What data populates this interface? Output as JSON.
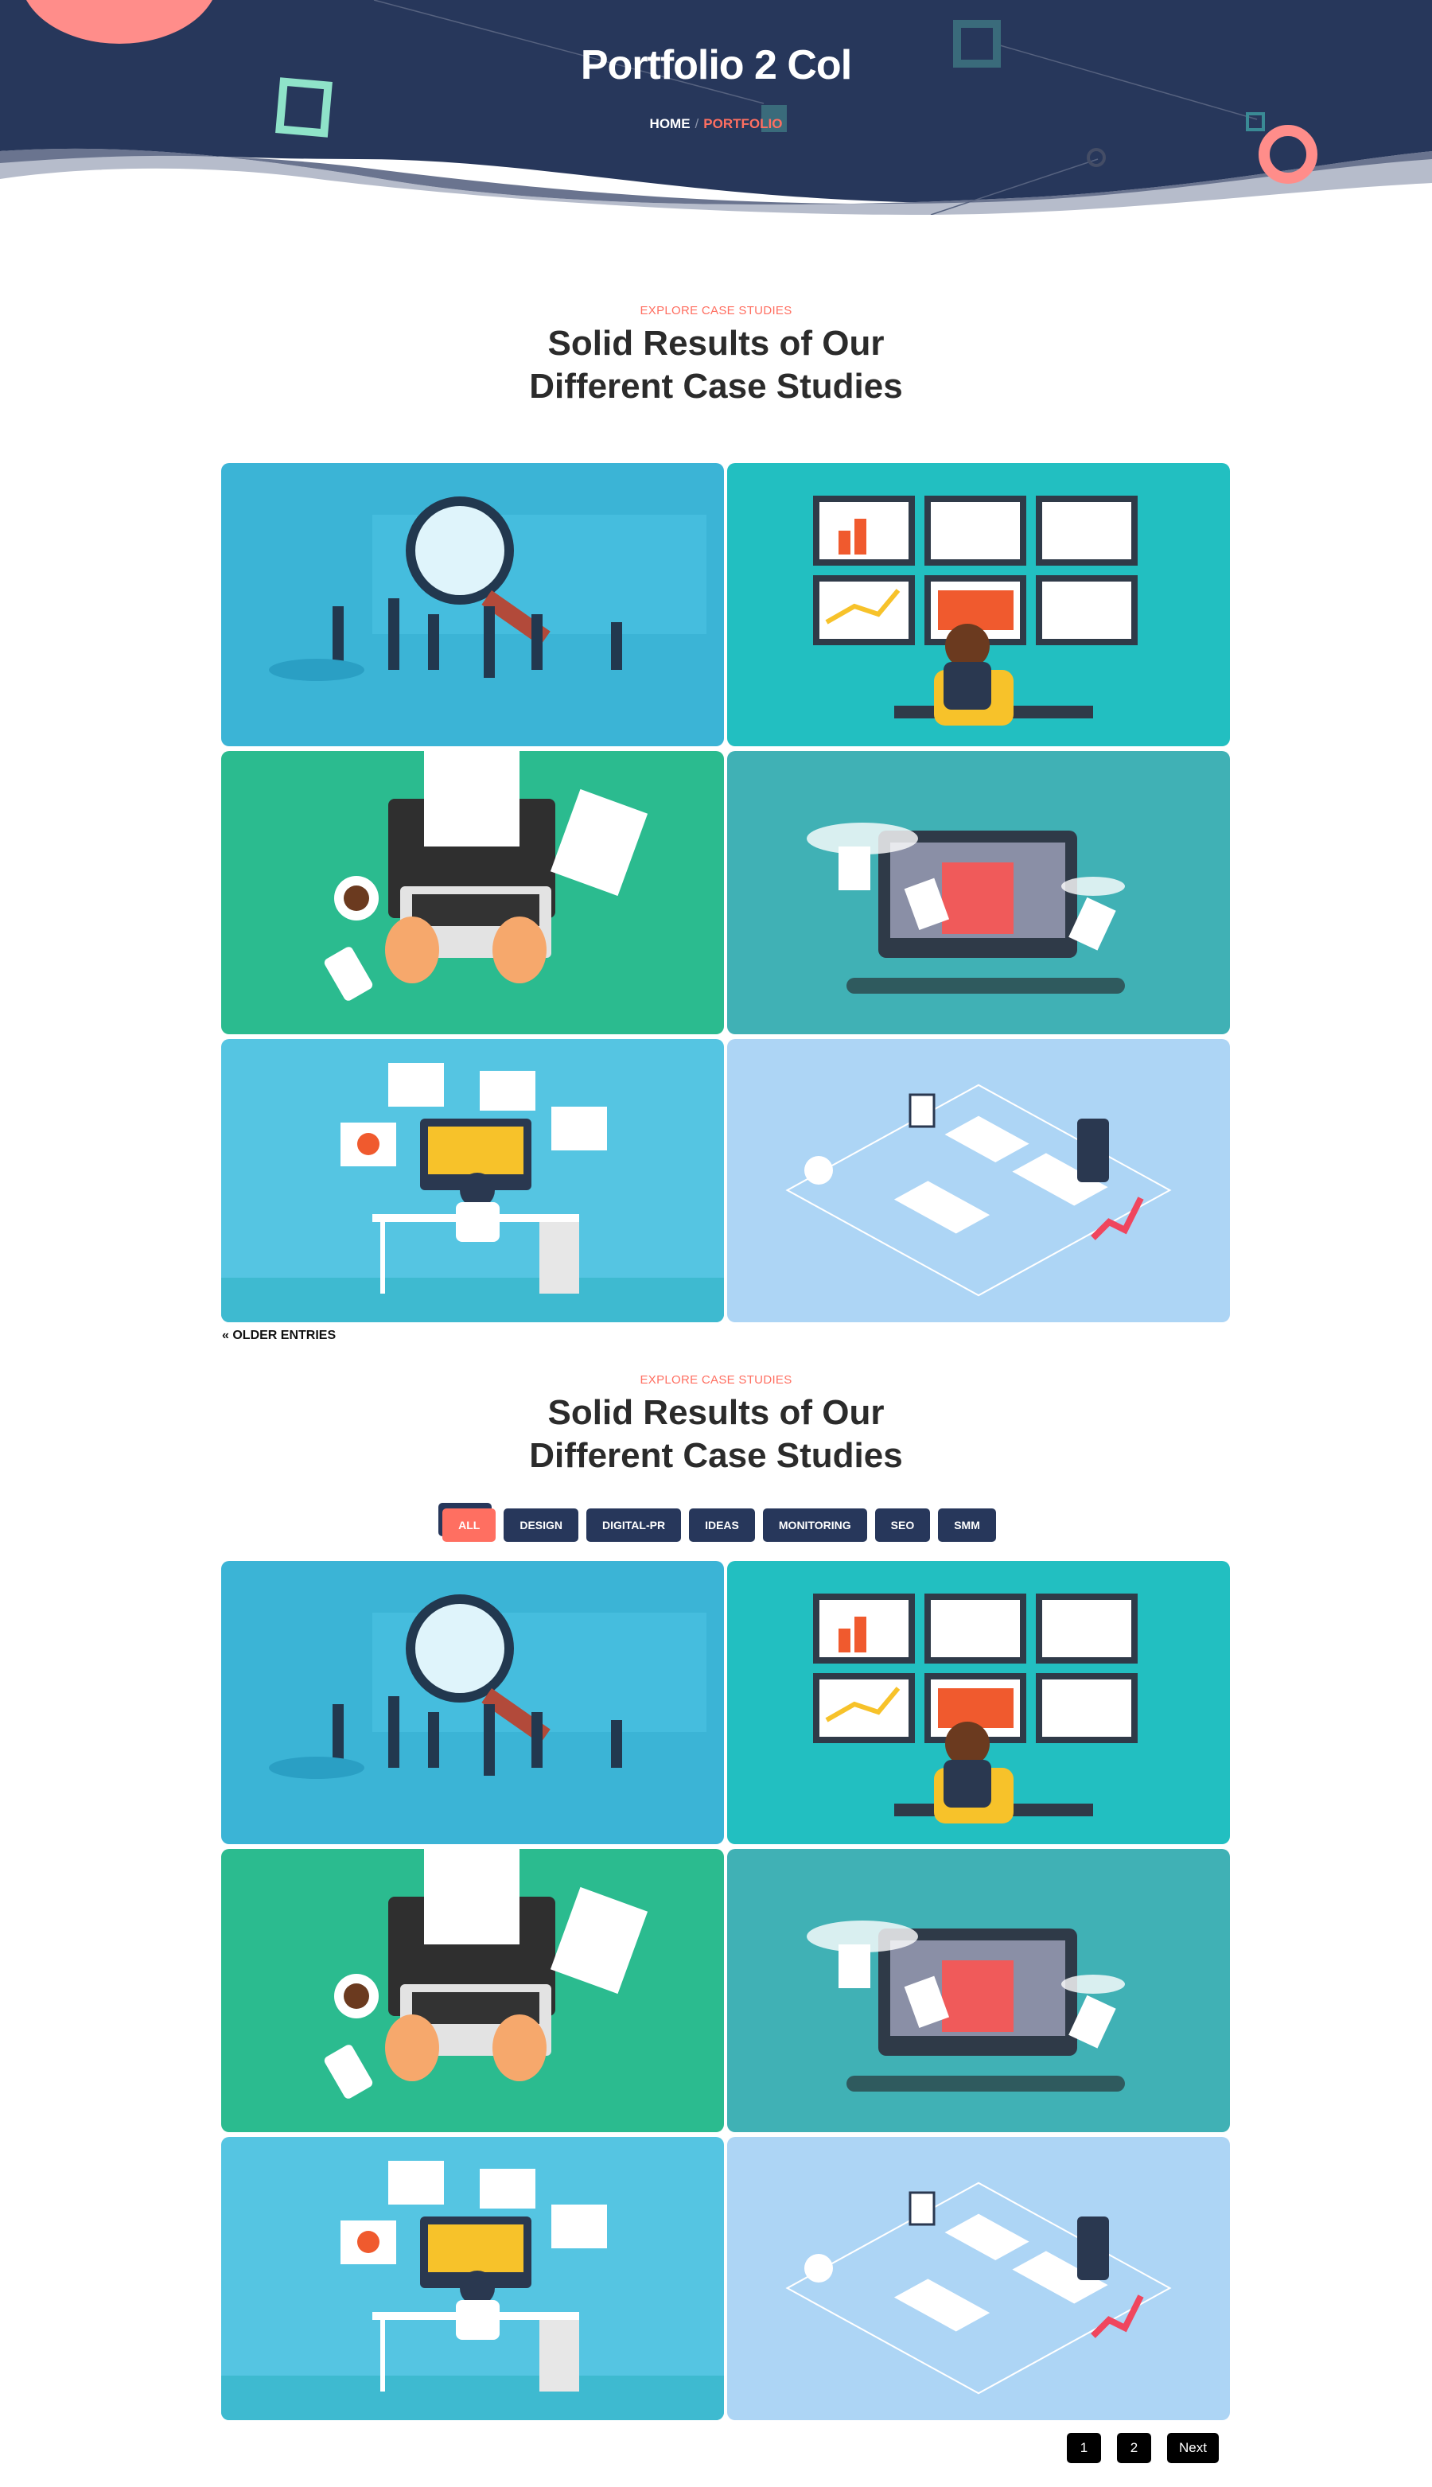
{
  "hero": {
    "title": "Portfolio 2 Col",
    "breadcrumb": {
      "home": "HOME",
      "separator": "/",
      "current": "PORTFOLIO"
    }
  },
  "colors": {
    "navy": "#27375b",
    "coral": "#ff6f61",
    "mint": "#8fe3c9"
  },
  "section1": {
    "eyebrow": "EXPLORE CASE STUDIES",
    "heading_line1": "Solid Results of Our",
    "heading_line2": "Different Case Studies"
  },
  "older_entries": "« OLDER ENTRIES",
  "section2": {
    "eyebrow": "EXPLORE CASE STUDIES",
    "heading_line1": "Solid Results of Our",
    "heading_line2": "Different Case Studies"
  },
  "filters": [
    {
      "label": "ALL",
      "active": true
    },
    {
      "label": "DESIGN"
    },
    {
      "label": "DIGITAL-PR"
    },
    {
      "label": "IDEAS"
    },
    {
      "label": "MONITORING"
    },
    {
      "label": "SEO"
    },
    {
      "label": "SMM"
    }
  ],
  "portfolio_items": [
    {
      "illustration": "team-with-magnifying-glass-search",
      "bg": "#3bb4d6"
    },
    {
      "illustration": "analytics-dashboard-monitors",
      "bg": "#22bfc1"
    },
    {
      "illustration": "laptop-typewriter-workspace",
      "bg": "#2bbb8f"
    },
    {
      "illustration": "voting-ballot-box-monitor",
      "bg": "#40b1b5"
    },
    {
      "illustration": "online-shop-desk",
      "bg": "#55c5e2"
    },
    {
      "illustration": "isometric-office",
      "bg": "#add5f5"
    }
  ],
  "pagination": {
    "pages": [
      "1",
      "2"
    ],
    "next": "Next"
  }
}
